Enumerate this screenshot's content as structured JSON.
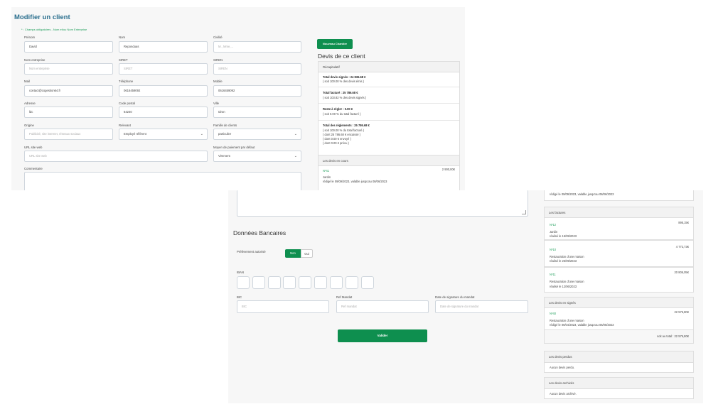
{
  "form": {
    "title": "Modifier un client",
    "required_note": "* : Champs obligatoires - Nom et/ou Nom Entreprise",
    "fields": {
      "prenom": {
        "label": "Prénom",
        "value": "David"
      },
      "nom": {
        "label": "Nom",
        "value": "Reponduas"
      },
      "civilite": {
        "label": "Civilité",
        "placeholder": "M., Mme,..."
      },
      "nom_entreprise": {
        "label": "Nom entreprise",
        "placeholder": "Nom entreprise"
      },
      "siret": {
        "label": "SIRET",
        "placeholder": "SIRET"
      },
      "siren": {
        "label": "SIREN",
        "placeholder": "SIREN"
      },
      "mail": {
        "label": "Mail",
        "value": "contact@cogestion64.fr"
      },
      "telephone": {
        "label": "Téléphone",
        "value": "0616459092"
      },
      "mobile": {
        "label": "Mobile",
        "value": "0616459092"
      },
      "adresse": {
        "label": "Adresse",
        "value": "ldc"
      },
      "code_postal": {
        "label": "Code postal",
        "value": "64240"
      },
      "ville": {
        "label": "Ville",
        "value": "Idron"
      },
      "origine": {
        "label": "Origine",
        "placeholder": "Publicité, site internet, réseaux sociaux"
      },
      "releve": {
        "label": "Relevant",
        "value": "Employé référent"
      },
      "famille": {
        "label": "Famille de clients",
        "value": "particulier"
      },
      "url": {
        "label": "URL site web",
        "placeholder": "URL site web"
      },
      "paiement": {
        "label": "Moyen de paiement par défaut",
        "value": "Virement"
      },
      "commentaire": {
        "label": "Commentaire"
      }
    },
    "new_chantier_button": "Nouveau Chantier"
  },
  "devis": {
    "title": "Devis de ce client",
    "recap_header": "Récapitulatif",
    "recap": [
      {
        "title": "Total devis signés : 24 836.68 €",
        "lines": [
          "( soit 100.00 % des devis émis )"
        ]
      },
      {
        "title": "Total facturé : 25 786.68 €",
        "lines": [
          "( soit 103.82 % des devis signés )"
        ]
      },
      {
        "title": "Reste à régler : 0.00 €",
        "lines": [
          "( soit 0.00 % du total facturé )"
        ]
      },
      {
        "title": "Total des règlements : 25 786.68 €",
        "lines": [
          "( soit 100.00 % du total facturé )",
          "( dont 25 786.68 € encaissé )",
          "( dont 0.00 € envoyé )",
          "( dont 0.00 € prévu )"
        ]
      }
    ],
    "en_cours": {
      "header": "Les devis en cours",
      "items": [
        {
          "num": "Nº41",
          "amount": "2 900,00€",
          "desc": "Jardin",
          "date": "rédigé le 09/09/2023, valable jusqu'au 08/06/2023"
        }
      ],
      "partial_line": "rédigé le 09/09/2023, valable jusqu'au 08/06/2023"
    },
    "factures": {
      "header": "Les factures",
      "items": [
        {
          "num": "Nº12",
          "amount": "895,15€",
          "desc": "Jardin",
          "date": "réalisé le 15/09/2023"
        },
        {
          "num": "Nº10",
          "amount": "4 772,73€",
          "desc": "Restauration d'une maison",
          "date": "réalisé le 26/09/2023"
        },
        {
          "num": "Nº11",
          "amount": "20 806,05€",
          "desc": "Restauration d'une maison",
          "date": "réalisé le 12/06/2023"
        }
      ]
    },
    "signes": {
      "header": "Les devis en signés",
      "items": [
        {
          "num": "Nº40",
          "amount": "22 576,80€",
          "desc": "Restauration d'une maison",
          "date": "rédigé le 06/04/2023, valable jusqu'au 06/05/2023"
        }
      ],
      "total": "soit au total : 22 576,80€"
    },
    "perdus": {
      "header": "Les devis perdus",
      "text": "Aucun devis perdu."
    },
    "archives": {
      "header": "Les devis archivés",
      "text": "Aucun devis archivé."
    }
  },
  "bank": {
    "title": "Données Bancaires",
    "prelevement_label": "Prélèvement autorisé",
    "toggle_non": "Non",
    "toggle_oui": "Oui",
    "iban_label": "IBAN",
    "bic": {
      "label": "BIC",
      "placeholder": "BIC"
    },
    "ref_mandat": {
      "label": "Ref Mandat",
      "placeholder": "Ref mandat"
    },
    "date_mandat": {
      "label": "Date de signature du mandat",
      "placeholder": "Date de signature du mandat"
    },
    "submit": "Valider"
  },
  "colors": {
    "accent": "#0e8f4f",
    "title": "#2b6f8e",
    "link": "#1e9e5a"
  }
}
